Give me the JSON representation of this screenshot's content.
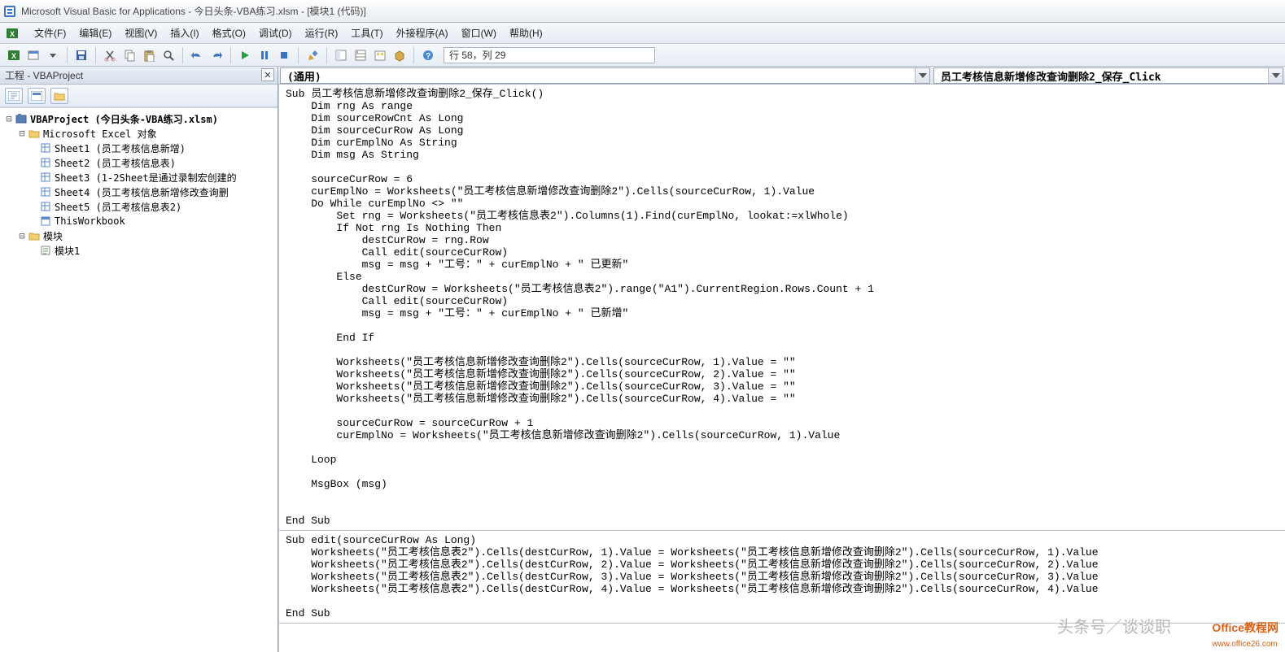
{
  "title": "Microsoft Visual Basic for Applications - 今日头条-VBA练习.xlsm - [模块1 (代码)]",
  "menu": {
    "file": "文件(F)",
    "edit": "编辑(E)",
    "view": "视图(V)",
    "insert": "插入(I)",
    "format": "格式(O)",
    "debug": "调试(D)",
    "run": "运行(R)",
    "tools": "工具(T)",
    "addins": "外接程序(A)",
    "window": "窗口(W)",
    "help": "帮助(H)"
  },
  "position_text": "行 58，列 29",
  "project_pane_title": "工程 - VBAProject",
  "tree": {
    "root": "VBAProject (今日头条-VBA练习.xlsm)",
    "excel_objects": "Microsoft Excel 对象",
    "sheet1": "Sheet1 (员工考核信息新增)",
    "sheet2": "Sheet2 (员工考核信息表)",
    "sheet3": "Sheet3 (1-2Sheet是通过录制宏创建的",
    "sheet4": "Sheet4 (员工考核信息新增修改查询删",
    "sheet5": "Sheet5 (员工考核信息表2)",
    "thiswb": "ThisWorkbook",
    "modules": "模块",
    "module1": "模块1"
  },
  "dropdown_left": "(通用)",
  "dropdown_right": "员工考核信息新增修改查询删除2_保存_Click",
  "code_main": "Sub 员工考核信息新增修改查询删除2_保存_Click()\n    Dim rng As range\n    Dim sourceRowCnt As Long\n    Dim sourceCurRow As Long\n    Dim curEmplNo As String\n    Dim msg As String\n\n    sourceCurRow = 6\n    curEmplNo = Worksheets(\"员工考核信息新增修改查询删除2\").Cells(sourceCurRow, 1).Value\n    Do While curEmplNo <> \"\"\n        Set rng = Worksheets(\"员工考核信息表2\").Columns(1).Find(curEmplNo, lookat:=xlWhole)\n        If Not rng Is Nothing Then\n            destCurRow = rng.Row\n            Call edit(sourceCurRow)\n            msg = msg + \"工号：\" + curEmplNo + \" 已更新\"\n        Else\n            destCurRow = Worksheets(\"员工考核信息表2\").range(\"A1\").CurrentRegion.Rows.Count + 1\n            Call edit(sourceCurRow)\n            msg = msg + \"工号：\" + curEmplNo + \" 已新增\"\n\n        End If\n\n        Worksheets(\"员工考核信息新增修改查询删除2\").Cells(sourceCurRow, 1).Value = \"\"\n        Worksheets(\"员工考核信息新增修改查询删除2\").Cells(sourceCurRow, 2).Value = \"\"\n        Worksheets(\"员工考核信息新增修改查询删除2\").Cells(sourceCurRow, 3).Value = \"\"\n        Worksheets(\"员工考核信息新增修改查询删除2\").Cells(sourceCurRow, 4).Value = \"\"\n\n        sourceCurRow = sourceCurRow + 1\n        curEmplNo = Worksheets(\"员工考核信息新增修改查询删除2\").Cells(sourceCurRow, 1).Value\n\n    Loop\n\n    MsgBox (msg)\n\n\nEnd Sub",
  "code_edit": "Sub edit(sourceCurRow As Long)\n    Worksheets(\"员工考核信息表2\").Cells(destCurRow, 1).Value = Worksheets(\"员工考核信息新增修改查询删除2\").Cells(sourceCurRow, 1).Value\n    Worksheets(\"员工考核信息表2\").Cells(destCurRow, 2).Value = Worksheets(\"员工考核信息新增修改查询删除2\").Cells(sourceCurRow, 2).Value\n    Worksheets(\"员工考核信息表2\").Cells(destCurRow, 3).Value = Worksheets(\"员工考核信息新增修改查询删除2\").Cells(sourceCurRow, 3).Value\n    Worksheets(\"员工考核信息表2\").Cells(destCurRow, 4).Value = Worksheets(\"员工考核信息新增修改查询删除2\").Cells(sourceCurRow, 4).Value\n\nEnd Sub",
  "watermark_channel": "头条号／谈谈职",
  "watermark_site": "Office教程网",
  "watermark_url": "www.office26.com"
}
